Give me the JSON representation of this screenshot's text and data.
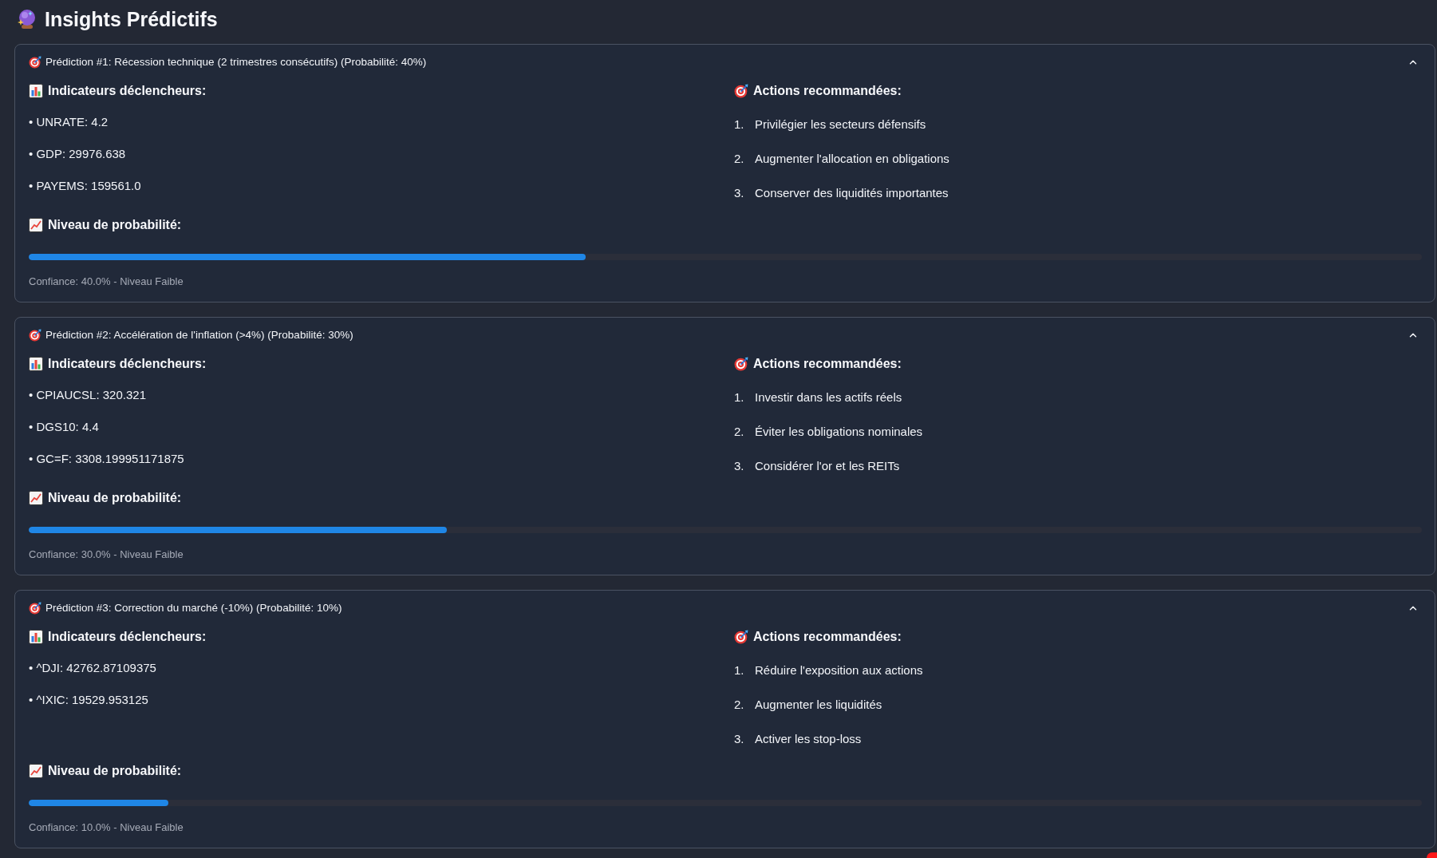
{
  "page": {
    "title": "Insights Prédictifs"
  },
  "predictions": [
    {
      "title": "Prédiction #1: Récession technique (2 trimestres consécutifs) (Probabilité: 40%)",
      "expanded": true,
      "indicators_heading": "Indicateurs déclencheurs:",
      "indicators": [
        "• UNRATE: 4.2",
        "• GDP: 29976.638",
        "• PAYEMS: 159561.0"
      ],
      "actions_heading": "Actions recommandées:",
      "actions": [
        {
          "number": "1.",
          "text": "Privilégier les secteurs défensifs"
        },
        {
          "number": "2.",
          "text": "Augmenter l'allocation en obligations"
        },
        {
          "number": "3.",
          "text": "Conserver des liquidités importantes"
        }
      ],
      "probability_heading": "Niveau de probabilité:",
      "level": 0.4,
      "confidence": "Confiance: 40.0% - Niveau Faible"
    },
    {
      "title": "Prédiction #2: Accélération de l'inflation (>4%) (Probabilité: 30%)",
      "expanded": true,
      "indicators_heading": "Indicateurs déclencheurs:",
      "indicators": [
        "• CPIAUCSL: 320.321",
        "• DGS10: 4.4",
        "• GC=F: 3308.199951171875"
      ],
      "actions_heading": "Actions recommandées:",
      "actions": [
        {
          "number": "1.",
          "text": "Investir dans les actifs réels"
        },
        {
          "number": "2.",
          "text": "Éviter les obligations nominales"
        },
        {
          "number": "3.",
          "text": "Considérer l'or et les REITs"
        }
      ],
      "probability_heading": "Niveau de probabilité:",
      "level": 0.3,
      "confidence": "Confiance: 30.0% - Niveau Faible"
    },
    {
      "title": "Prédiction #3: Correction du marché (-10%) (Probabilité: 10%)",
      "expanded": true,
      "indicators_heading": "Indicateurs déclencheurs:",
      "indicators": [
        "• ^DJI: 42762.87109375",
        "• ^IXIC: 19529.953125"
      ],
      "actions_heading": "Actions recommandées:",
      "actions": [
        {
          "number": "1.",
          "text": "Réduire l'exposition aux actions"
        },
        {
          "number": "2.",
          "text": "Augmenter les liquidités"
        },
        {
          "number": "3.",
          "text": "Activer les stop-loss"
        }
      ],
      "probability_heading": "Niveau de probabilité:",
      "level": 0.1,
      "confidence": "Confiance: 10.0% - Niveau Faible"
    }
  ]
}
